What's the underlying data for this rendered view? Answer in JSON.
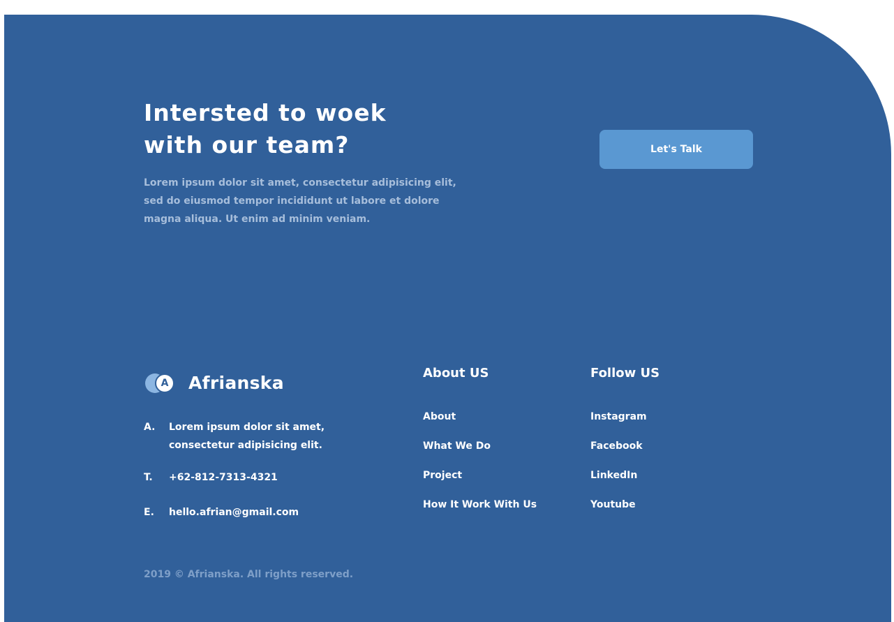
{
  "cta": {
    "title_line1": "Intersted to woek",
    "title_line2": "with our team?",
    "description": "Lorem ipsum dolor sit amet, consectetur adipisicing elit, sed do eiusmod tempor incididunt ut labore et dolore magna aliqua. Ut enim ad minim veniam.",
    "button_label": "Let's Talk"
  },
  "brand": {
    "logo_letter": "A",
    "name": "Afrianska"
  },
  "contact": {
    "address_key": "A.",
    "address_line1": "Lorem ipsum dolor sit amet,",
    "address_line2": "consectetur adipisicing elit.",
    "phone_key": "T.",
    "phone": "+62-812-7313-4321",
    "email_key": "E.",
    "email": "hello.afrian@gmail.com"
  },
  "about": {
    "heading": "About US",
    "links": [
      "About",
      "What We Do",
      "Project",
      "How It Work With Us"
    ]
  },
  "follow": {
    "heading": "Follow US",
    "links": [
      "Instagram",
      "Facebook",
      "LinkedIn",
      "Youtube"
    ]
  },
  "copyright": "2019 © Afrianska. All rights reserved.",
  "colors": {
    "panel": "#31609a",
    "button": "#5a98d2",
    "muted_text": "#a7bedb"
  }
}
